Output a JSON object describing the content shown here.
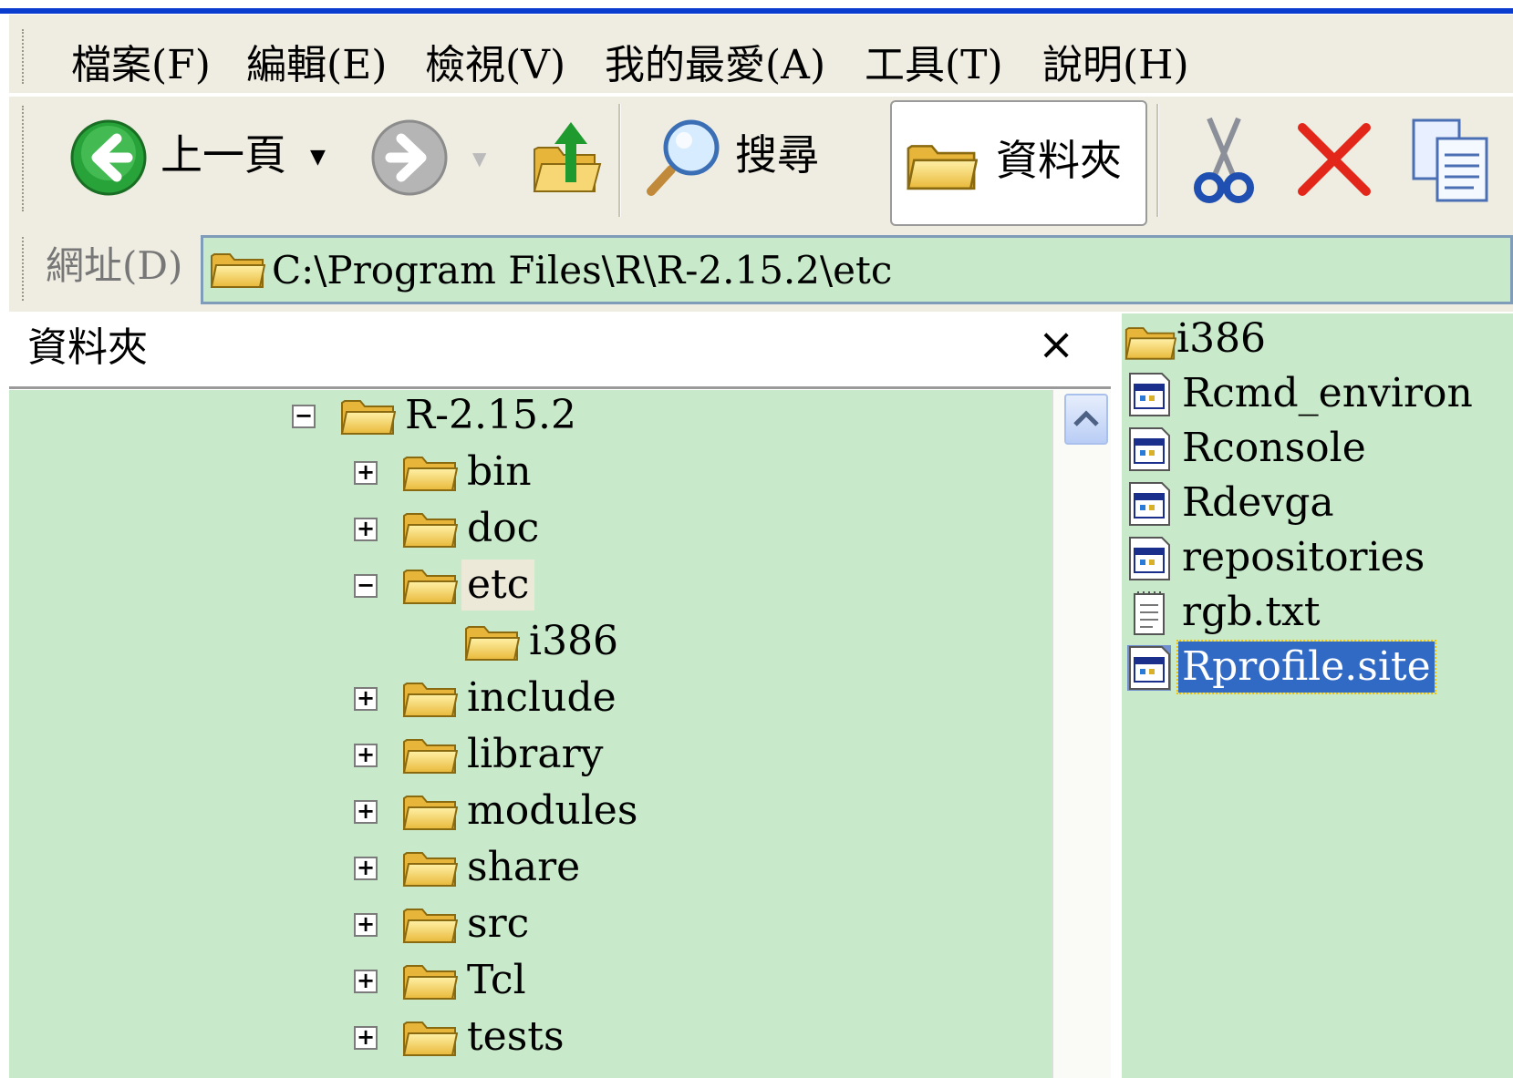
{
  "menubar": {
    "items": [
      "檔案(F)",
      "編輯(E)",
      "檢視(V)",
      "我的最愛(A)",
      "工具(T)",
      "說明(H)"
    ]
  },
  "toolbar": {
    "back_label": "上一頁",
    "search_label": "搜尋",
    "folders_label": "資料夾"
  },
  "address": {
    "label": "網址(D)",
    "value": "C:\\Program Files\\R\\R-2.15.2\\etc"
  },
  "folders_pane": {
    "title": "資料夾",
    "close_glyph": "×"
  },
  "tree": {
    "root": "R-2.15.2",
    "children": [
      "bin",
      "doc",
      "etc",
      "i386",
      "include",
      "library",
      "modules",
      "share",
      "src",
      "Tcl",
      "tests"
    ]
  },
  "files": {
    "items": [
      "i386",
      "Rcmd_environ",
      "Rconsole",
      "Rdevga",
      "repositories",
      "rgb.txt",
      "Rprofile.site"
    ],
    "selected": "Rprofile.site"
  },
  "colors": {
    "pane_bg": "#c8eaca",
    "toolbar_bg": "#efece1",
    "title_blue": "#0a3dcf",
    "selection": "#316ac5"
  }
}
